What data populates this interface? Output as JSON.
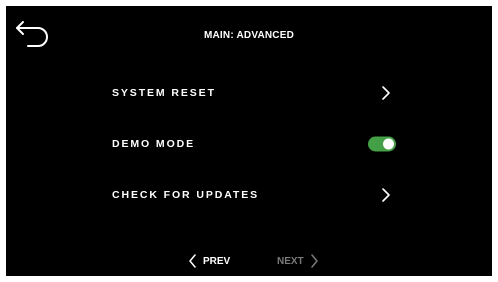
{
  "header": {
    "title": "MAIN: ADVANCED",
    "back_icon": "back-arrow-icon"
  },
  "menu": {
    "items": [
      {
        "label": "SYSTEM RESET",
        "control": "chevron-right-icon"
      },
      {
        "label": "DEMO MODE",
        "control": "toggle",
        "toggle_on": true
      },
      {
        "label": "CHECK FOR UPDATES",
        "control": "chevron-right-icon"
      }
    ]
  },
  "pager": {
    "prev_label": "PREV",
    "next_label": "NEXT",
    "next_enabled": false
  },
  "colors": {
    "background": "#000000",
    "text": "#ffffff",
    "toggle_on": "#43a047",
    "disabled_text": "#7a7a7a"
  }
}
